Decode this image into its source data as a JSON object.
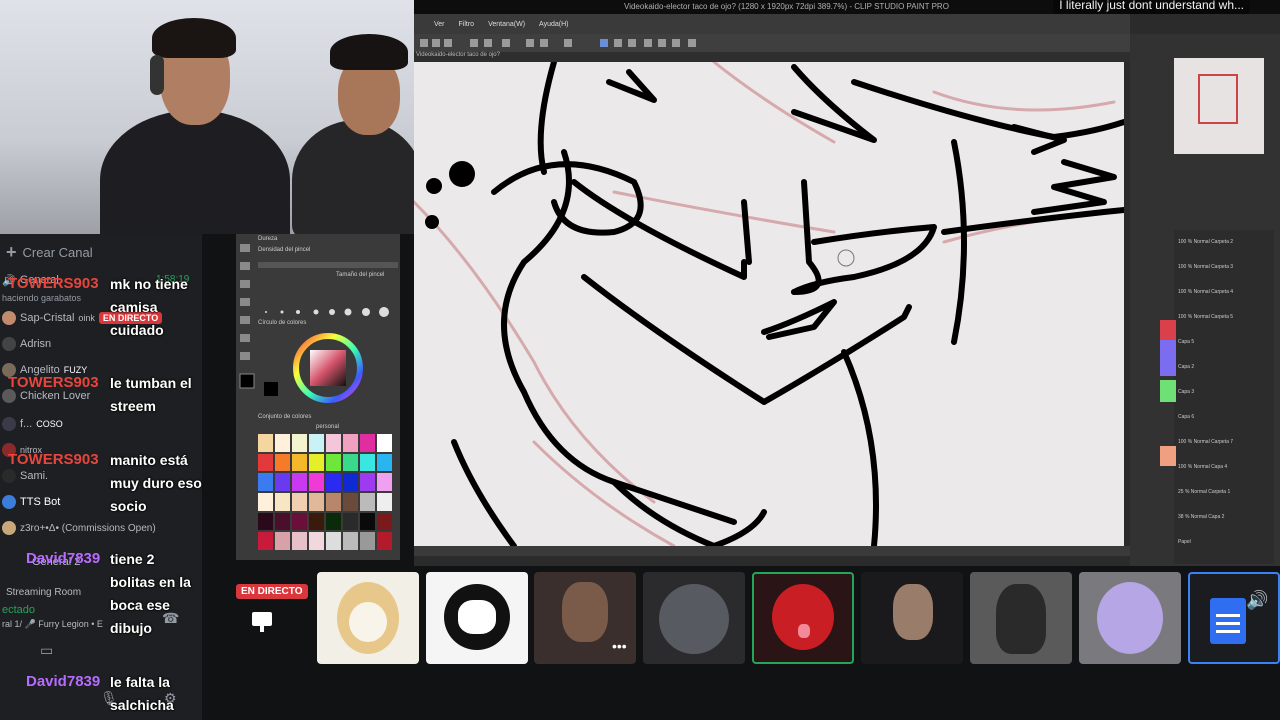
{
  "overlay_message": "I literally just dont understand wh...",
  "sidebar": {
    "create_channel": "Crear Canal",
    "timestamp": "1:58:19",
    "members": [
      {
        "name": "General"
      },
      {
        "name": "haciendo garabatos"
      },
      {
        "name": "Sap-Cristal",
        "extra": "oink",
        "badge": "EN DIRECTO"
      },
      {
        "name": "Adrisn"
      },
      {
        "name": "Angelito",
        "extra": "FUZY"
      },
      {
        "name": "Chicken Lover"
      },
      {
        "name": "f...",
        "extra": "COSO"
      },
      {
        "name": "nitrox"
      },
      {
        "name": "Sami."
      },
      {
        "name": "TTS Bot"
      },
      {
        "name": "z3ro+•Δ• (Commissions Open)"
      },
      {
        "name": "General 2"
      },
      {
        "name": "Streaming Room"
      },
      {
        "name": "ectado"
      },
      {
        "name": "ral 1/ 🎤 Furry Legion • E"
      }
    ]
  },
  "chat": [
    {
      "user": "TOWERS903",
      "color": "#e8453c",
      "text": "mk no tiene camisa cuidado"
    },
    {
      "user": "TOWERS903",
      "color": "#e8453c",
      "text": "le tumban el streem"
    },
    {
      "user": "TOWERS903",
      "color": "#e8453c",
      "text": "manito está muy duro eso socio"
    },
    {
      "user": "David7839",
      "color": "#b66bff",
      "text": "tiene 2 bolitas en la boca ese dibujo"
    },
    {
      "user": "David7839",
      "color": "#b66bff",
      "text": "le falta la salchicha"
    }
  ],
  "csp": {
    "title": "Videokaido-elector taco de ojo? (1280 x 1920px 72dpi 389.7%) - CLIP STUDIO PAINT PRO",
    "menu": [
      "Ver",
      "Filtro",
      "Ventana(W)",
      "Ayuda(H)"
    ],
    "tab": "Videokaido-elector taco de ojo?",
    "brush_labels": {
      "hardness": "Dureza",
      "density": "Densidad del pincel",
      "brush_size": "Tamaño del pincel",
      "color_circle": "Círculo de colores",
      "color_set": "Conjunto de colores",
      "palette": "personal"
    },
    "layers": [
      "100 % Normal Carpeta 2",
      "100 % Normal Carpeta 3",
      "100 % Normal Carpeta 4",
      "100 % Normal Carpeta 5",
      "Capa 5",
      "Capa 2",
      "Capa 3",
      "Capa 6",
      "100 % Normal Carpeta 7",
      "100 % Normal Capa 4",
      "25 % Normal Carpeta 1",
      "38 % Normal Capa 2",
      "Papel"
    ]
  },
  "tiles": {
    "live_label": "EN DIRECTO",
    "participants": [
      "stream-screen",
      "fox-avatar",
      "bw-creature-avatar",
      "webcam-person",
      "webcam-room",
      "apple-avatar",
      "webcam-boy",
      "dog-avatar",
      "anime-avatar",
      "docs-speaker"
    ]
  }
}
